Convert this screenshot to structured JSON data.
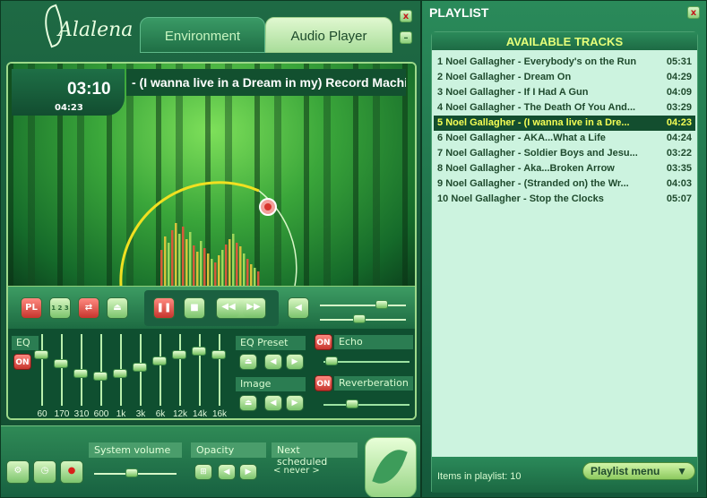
{
  "app": {
    "logo_text": "Alalena"
  },
  "tabs": {
    "environment": "Environment",
    "audio_player": "Audio Player"
  },
  "window": {
    "close": "x",
    "minimize": "–"
  },
  "now_playing": {
    "elapsed": "03:10",
    "total": "04:23",
    "title_scroll": "- (I wanna live in a Dream in my) Record Machine"
  },
  "controls": {
    "pl_label": "PL",
    "repeat_label": "1 2 3",
    "volume_level": 0.75,
    "balance_level": 0.45
  },
  "eq": {
    "label": "EQ",
    "on_label": "ON",
    "bands": [
      {
        "freq": "60",
        "level": 0.25
      },
      {
        "freq": "170",
        "level": 0.4
      },
      {
        "freq": "310",
        "level": 0.55
      },
      {
        "freq": "600",
        "level": 0.6
      },
      {
        "freq": "1k",
        "level": 0.55
      },
      {
        "freq": "3k",
        "level": 0.45
      },
      {
        "freq": "6k",
        "level": 0.35
      },
      {
        "freq": "12k",
        "level": 0.25
      },
      {
        "freq": "14k",
        "level": 0.2
      },
      {
        "freq": "16k",
        "level": 0.25
      }
    ],
    "preset_label": "EQ Preset",
    "image_label": "Image"
  },
  "effects": {
    "echo_label": "Echo",
    "echo_on": "ON",
    "echo_level": 0.02,
    "reverb_label": "Reverberation",
    "reverb_on": "ON",
    "reverb_level": 0.3
  },
  "bottom": {
    "system_volume_label": "System volume",
    "system_volume_level": 0.45,
    "opacity_label": "Opacity",
    "next_scheduled_label": "Next scheduled",
    "next_scheduled_value": "< never >"
  },
  "playlist": {
    "title": "PLAYLIST",
    "header": "AVAILABLE TRACKS",
    "tracks": [
      {
        "num": "1",
        "name": "Noel Gallagher - Everybody's on the Run",
        "dur": "05:31"
      },
      {
        "num": "2",
        "name": "Noel Gallagher - Dream On",
        "dur": "04:29"
      },
      {
        "num": "3",
        "name": "Noel Gallagher - If I Had A Gun",
        "dur": "04:09"
      },
      {
        "num": "4",
        "name": "Noel Gallagher - The Death Of You And...",
        "dur": "03:29"
      },
      {
        "num": "5",
        "name": "Noel Gallagher - (I wanna live in a Dre...",
        "dur": "04:23"
      },
      {
        "num": "6",
        "name": "Noel Gallagher - AKA...What a Life",
        "dur": "04:24"
      },
      {
        "num": "7",
        "name": "Noel Gallagher - Soldier Boys and Jesu...",
        "dur": "03:22"
      },
      {
        "num": "8",
        "name": "Noel Gallagher - Aka...Broken Arrow",
        "dur": "03:35"
      },
      {
        "num": "9",
        "name": "Noel Gallagher - (Stranded on) the Wr...",
        "dur": "04:03"
      },
      {
        "num": "10",
        "name": "Noel Gallagher - Stop the Clocks",
        "dur": "05:07"
      }
    ],
    "selected_index": 4,
    "count_text": "Items in playlist: 10",
    "menu_label": "Playlist menu"
  }
}
